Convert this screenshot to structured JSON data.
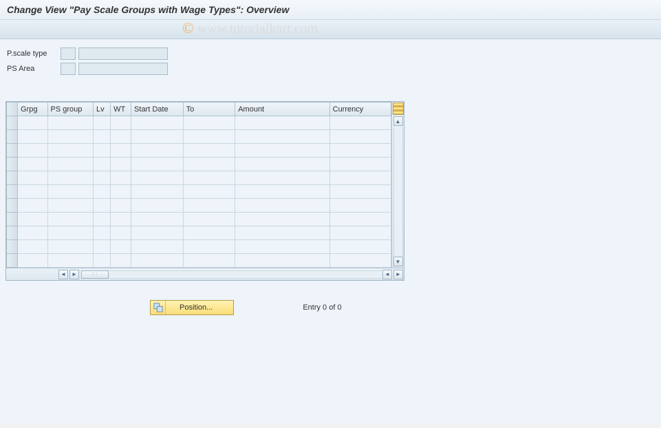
{
  "title": "Change View \"Pay Scale Groups with Wage Types\": Overview",
  "watermark": "www.tutorialkart.com",
  "form": {
    "pscale_type_label": "P.scale type",
    "pscale_type_code": "",
    "pscale_type_value": "",
    "ps_area_label": "PS Area",
    "ps_area_code": "",
    "ps_area_value": ""
  },
  "grid": {
    "columns": {
      "grpg": "Grpg",
      "ps_group": "PS group",
      "lv": "Lv",
      "wt": "WT",
      "start_date": "Start Date",
      "to": "To",
      "amount": "Amount",
      "currency": "Currency"
    },
    "rows": [
      {
        "grpg": "",
        "ps_group": "",
        "lv": "",
        "wt": "",
        "start_date": "",
        "to": "",
        "amount": "",
        "currency": ""
      },
      {
        "grpg": "",
        "ps_group": "",
        "lv": "",
        "wt": "",
        "start_date": "",
        "to": "",
        "amount": "",
        "currency": ""
      },
      {
        "grpg": "",
        "ps_group": "",
        "lv": "",
        "wt": "",
        "start_date": "",
        "to": "",
        "amount": "",
        "currency": ""
      },
      {
        "grpg": "",
        "ps_group": "",
        "lv": "",
        "wt": "",
        "start_date": "",
        "to": "",
        "amount": "",
        "currency": ""
      },
      {
        "grpg": "",
        "ps_group": "",
        "lv": "",
        "wt": "",
        "start_date": "",
        "to": "",
        "amount": "",
        "currency": ""
      },
      {
        "grpg": "",
        "ps_group": "",
        "lv": "",
        "wt": "",
        "start_date": "",
        "to": "",
        "amount": "",
        "currency": ""
      },
      {
        "grpg": "",
        "ps_group": "",
        "lv": "",
        "wt": "",
        "start_date": "",
        "to": "",
        "amount": "",
        "currency": ""
      },
      {
        "grpg": "",
        "ps_group": "",
        "lv": "",
        "wt": "",
        "start_date": "",
        "to": "",
        "amount": "",
        "currency": ""
      },
      {
        "grpg": "",
        "ps_group": "",
        "lv": "",
        "wt": "",
        "start_date": "",
        "to": "",
        "amount": "",
        "currency": ""
      },
      {
        "grpg": "",
        "ps_group": "",
        "lv": "",
        "wt": "",
        "start_date": "",
        "to": "",
        "amount": "",
        "currency": ""
      },
      {
        "grpg": "",
        "ps_group": "",
        "lv": "",
        "wt": "",
        "start_date": "",
        "to": "",
        "amount": "",
        "currency": ""
      }
    ]
  },
  "footer": {
    "position_label": "Position...",
    "entry_text": "Entry 0 of 0"
  }
}
